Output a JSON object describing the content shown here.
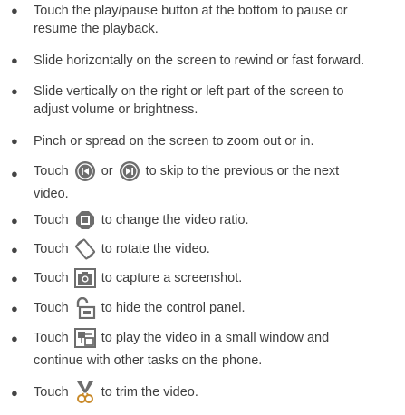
{
  "icon_color": "#6d6d6d",
  "items": [
    {
      "lines": [
        "Touch the play/pause button at the bottom to pause or",
        "resume the playback."
      ]
    },
    {
      "lines": [
        "Slide horizontally on the screen to rewind or fast forward."
      ]
    },
    {
      "lines": [
        "Slide vertically on the right or left part of the screen to",
        "adjust volume or brightness."
      ]
    },
    {
      "lines": [
        "Pinch or spread on the screen to zoom out or in."
      ]
    },
    {
      "pre": "Touch",
      "mid": "or",
      "post": "to skip to the previous or the next",
      "line2": "video.",
      "icons": [
        "previous-icon",
        "next-icon"
      ]
    },
    {
      "pre": "Touch",
      "post": "to change the video ratio.",
      "icon": "ratio-icon"
    },
    {
      "pre": "Touch",
      "post": "to rotate the video.",
      "icon": "rotate-icon"
    },
    {
      "pre": "Touch",
      "post": "to capture a screenshot.",
      "icon": "screenshot-icon"
    },
    {
      "pre": "Touch",
      "post": "to hide the control panel.",
      "icon": "lock-icon"
    },
    {
      "pre": "Touch",
      "post": "to play the video in a small window and",
      "line2": "continue with other tasks on the phone.",
      "icon": "small-window-icon"
    },
    {
      "pre": "Touch",
      "post": "to trim the video.",
      "icon": "trim-icon"
    }
  ]
}
